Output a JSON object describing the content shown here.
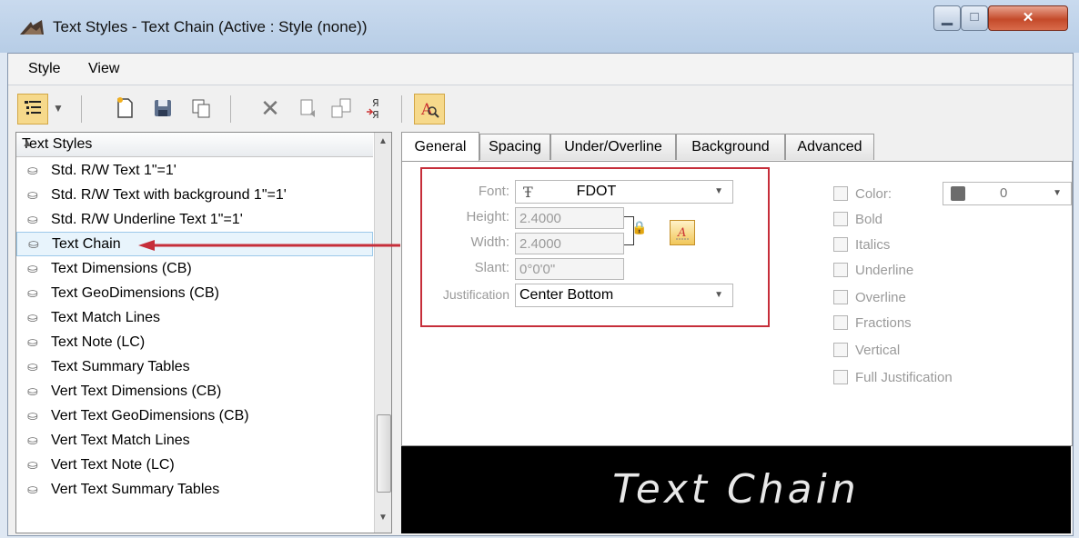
{
  "window": {
    "title": "Text Styles - Text Chain (Active : Style (none))"
  },
  "menu": {
    "style_label": "Style",
    "view_label": "View"
  },
  "toolbar": {
    "icons": [
      "list-view-icon",
      "dropdown-arrow-icon",
      "new-style-icon",
      "save-icon",
      "copy-icon",
      "delete-icon",
      "update-icon",
      "replace-icon",
      "import-icon",
      "text-preview-icon"
    ]
  },
  "list": {
    "header": "Text Styles",
    "items": [
      {
        "label": "Std. R/W Text 1\"=1'"
      },
      {
        "label": "Std. R/W Text with background 1\"=1'"
      },
      {
        "label": "Std. R/W Underline Text 1\"=1'"
      },
      {
        "label": "Text Chain"
      },
      {
        "label": "Text Dimensions (CB)"
      },
      {
        "label": "Text GeoDimensions (CB)"
      },
      {
        "label": "Text Match Lines"
      },
      {
        "label": "Text Note (LC)"
      },
      {
        "label": "Text Summary Tables"
      },
      {
        "label": "Vert Text Dimensions (CB)"
      },
      {
        "label": "Vert Text GeoDimensions (CB)"
      },
      {
        "label": "Vert Text Match Lines"
      },
      {
        "label": "Vert Text Note (LC)"
      },
      {
        "label": "Vert Text Summary Tables"
      }
    ],
    "selected": "Text Chain"
  },
  "tabs": {
    "general": "General",
    "spacing": "Spacing",
    "underoverline": "Under/Overline",
    "background": "Background",
    "advanced": "Advanced",
    "active": "General"
  },
  "general": {
    "font_label": "Font:",
    "font_value": "FDOT",
    "height_label": "Height:",
    "height_value": "2.4000",
    "width_label": "Width:",
    "width_value": "2.4000",
    "slant_label": "Slant:",
    "slant_value": "0°0'0\"",
    "justification_label": "Justification",
    "justification_value": "Center Bottom",
    "color_label": "Color:",
    "color_value": "0",
    "bold_label": "Bold",
    "italics_label": "Italics",
    "underline_label": "Underline",
    "overline_label": "Overline",
    "fractions_label": "Fractions",
    "vertical_label": "Vertical",
    "full_justification_label": "Full Justification"
  },
  "preview": {
    "text": "Text Chain"
  },
  "colors": {
    "highlight_box": "#c62e3a",
    "selected_row": "#e8f4fc",
    "preview_bg": "#000000"
  }
}
